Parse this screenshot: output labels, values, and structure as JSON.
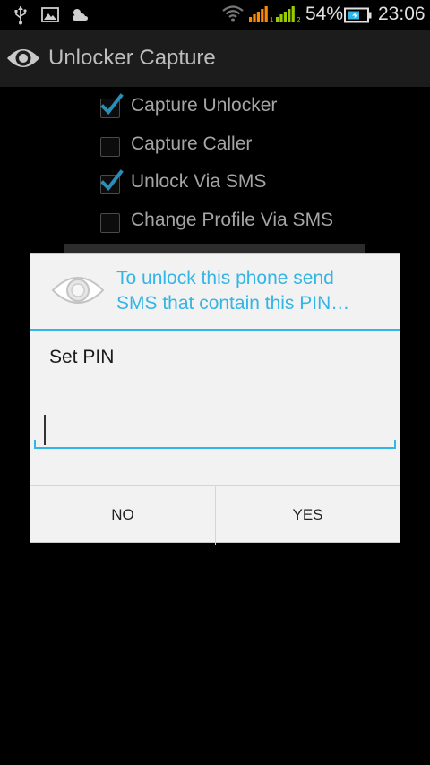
{
  "status_bar": {
    "battery_percent": "54%",
    "time": "23:06",
    "icons": [
      "usb-icon",
      "image-icon",
      "weather-icon",
      "wifi-icon",
      "signal-sim1-icon",
      "signal-sim2-icon",
      "battery-charging-icon"
    ]
  },
  "action_bar": {
    "title": "Unlocker Capture",
    "icon": "eye-icon"
  },
  "settings": {
    "items": [
      {
        "label": "Capture Unlocker",
        "checked": true
      },
      {
        "label": "Capture Caller",
        "checked": false
      },
      {
        "label": "Unlock Via SMS",
        "checked": true
      },
      {
        "label": "Change Profile Via SMS",
        "checked": false
      }
    ]
  },
  "dialog": {
    "icon": "eye-icon",
    "title_line1": "To unlock this phone send",
    "title_line2": "SMS that contain this PIN…",
    "message": "Set PIN",
    "pin_value": "",
    "no_label": "NO",
    "yes_label": "YES"
  },
  "colors": {
    "accent": "#33b5e5",
    "signal_orange": "#ff8800",
    "signal_green": "#99cc00",
    "background": "#000000",
    "dialog_background": "#f2f2f2"
  }
}
